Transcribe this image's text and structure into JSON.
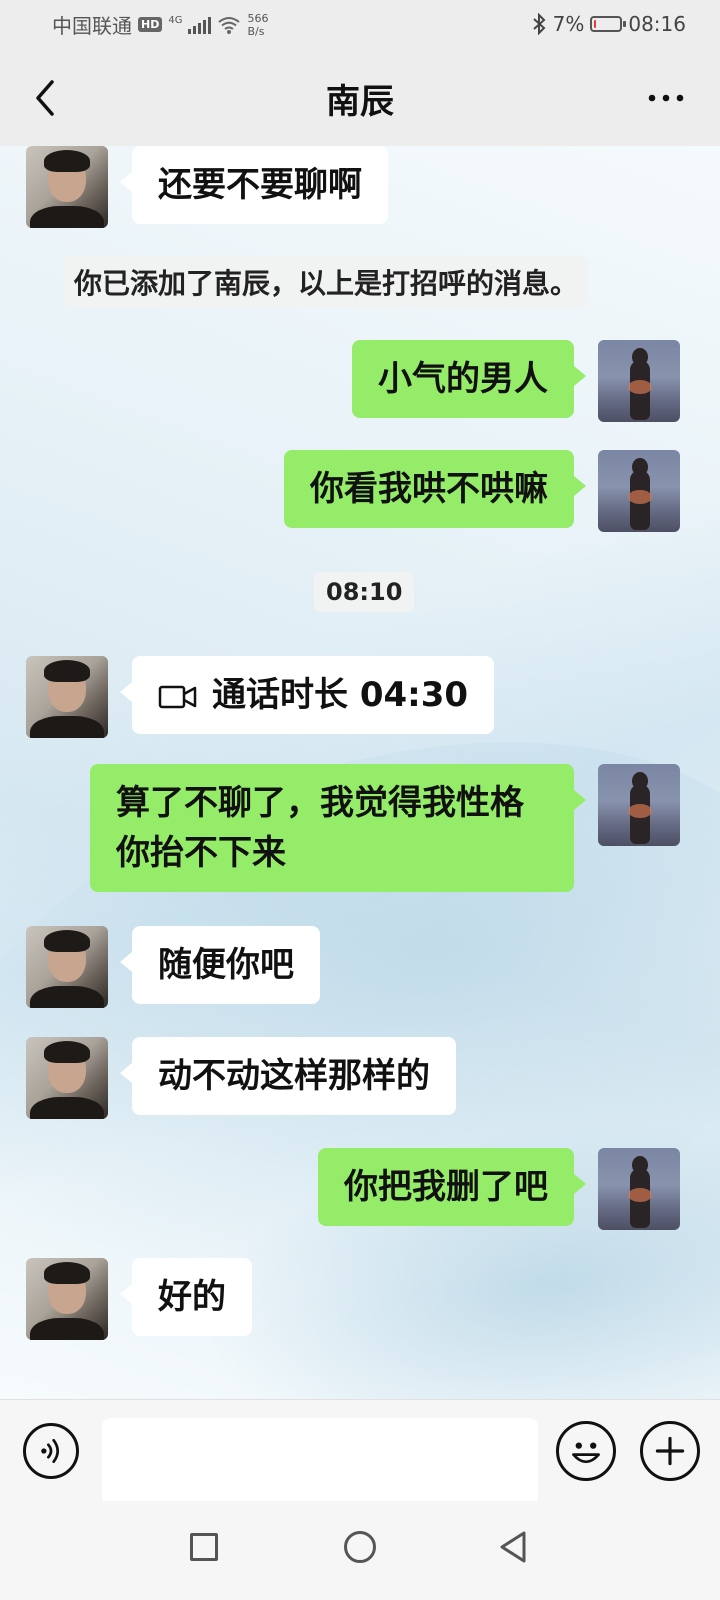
{
  "status_bar": {
    "carrier": "中国联通",
    "hd": "HD",
    "network": "4G",
    "speed_value": "566",
    "speed_unit": "B/s",
    "bluetooth_icon": "bluetooth-icon",
    "battery_percent": "7%",
    "battery_level": 0.07,
    "time": "08:16"
  },
  "header": {
    "title": "南辰",
    "back_icon": "chevron-left-icon",
    "more_icon": "more-dots-icon"
  },
  "messages": [
    {
      "side": "in",
      "text": "还要不要聊啊"
    },
    {
      "type": "system",
      "text": "你已添加了南辰，以上是打招呼的消息。"
    },
    {
      "side": "out",
      "text": "小气的男人"
    },
    {
      "side": "out",
      "text": "你看我哄不哄嘛"
    },
    {
      "type": "time",
      "text": "08:10"
    },
    {
      "side": "in",
      "type": "call",
      "icon": "video-call-icon",
      "text": "通话时长 04:30"
    },
    {
      "side": "out",
      "text": "算了不聊了，我觉得我性格你抬不下来"
    },
    {
      "side": "in",
      "text": "随便你吧"
    },
    {
      "side": "in",
      "text": "动不动这样那样的"
    },
    {
      "side": "out",
      "text": "你把我删了吧"
    },
    {
      "side": "in",
      "text": "好的"
    }
  ],
  "input_bar": {
    "voice_icon": "voice-icon",
    "text_value": "",
    "emoji_icon": "emoji-icon",
    "plus_icon": "plus-icon"
  },
  "nav_bar": {
    "recent_icon": "square-icon",
    "home_icon": "circle-icon",
    "back_icon": "triangle-back-icon"
  },
  "colors": {
    "outgoing_bubble": "#95ec69",
    "incoming_bubble": "#ffffff",
    "background": "#ededed",
    "battery_low": "#e53935"
  }
}
